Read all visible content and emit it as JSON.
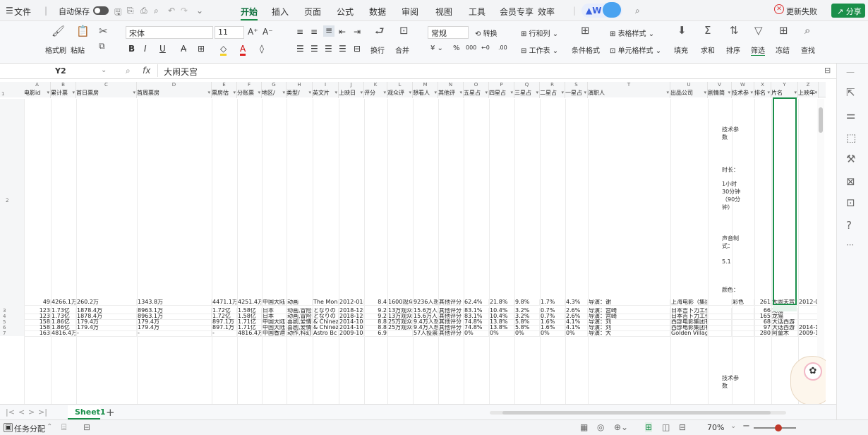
{
  "menubar": {
    "file": "文件",
    "autosave": "自动保存",
    "tabs": [
      "开始",
      "插入",
      "页面",
      "公式",
      "数据",
      "审阅",
      "视图",
      "工具",
      "会员专享",
      "效率"
    ],
    "active_tab": "开始",
    "update_failed": "更新失败",
    "share": "分享",
    "accent": "#1a8f4a"
  },
  "ribbon": {
    "format_painter": "格式刷",
    "paste": "粘贴",
    "font_name": "宋体",
    "font_size": "11",
    "number_format": "常规",
    "convert": "转换",
    "rows_cols": "行和列",
    "worksheet": "工作表",
    "wrap": "换行",
    "merge": "合并",
    "cond_format": "条件格式",
    "cell_style": "单元格样式",
    "table_style": "表格样式",
    "fill": "填充",
    "sum": "求和",
    "sort": "排序",
    "filter": "筛选",
    "freeze": "冻结",
    "find": "查找"
  },
  "formula_bar": {
    "cell_ref": "Y2",
    "fx": "fx",
    "value": "大闹天宫"
  },
  "columns": [
    "A",
    "B",
    "C",
    "D",
    "E",
    "F",
    "G",
    "H",
    "I",
    "J",
    "K",
    "L",
    "M",
    "N",
    "O",
    "P",
    "Q",
    "R",
    "S",
    "T",
    "U",
    "V",
    "W",
    "X",
    "Y",
    "Z"
  ],
  "headers": [
    "电影id",
    "累计票",
    "首日票房",
    "首周票房",
    "票房估",
    "分账票",
    "地区/",
    "类型/",
    "英文片",
    "上映日",
    "评分",
    "观众评",
    "想看人",
    "其他评",
    "五星占",
    "四星占",
    "三星占",
    "二星占",
    "一星占",
    "演职人",
    "出品公司",
    "剧情简",
    "技术参",
    "排名",
    "片名",
    "上映年"
  ],
  "row2_tech": {
    "label": "技术参数",
    "duration_label": "时长：",
    "duration": "1小时30分钟（90分钟）",
    "sound_label": "声音制式：",
    "sound": "5.1",
    "color_label": "颜色："
  },
  "rows": [
    {
      "num": "2",
      "a": "49",
      "b": "4266.1万",
      "c": "260.2万",
      "d": "1343.8万",
      "e": "4471.1万",
      "f": "4251.4万",
      "g": "中国大陆",
      "h": "动画",
      "i": "The Monk",
      "j": "2012-01-",
      "k": "8.4",
      "l": "1600观众",
      "m": "9236人想",
      "n": "其他评分",
      "o": "62.4%",
      "p": "21.8%",
      "q": "9.8%",
      "r": "1.7%",
      "s": "4.3%",
      "t": "导演：谢",
      "u": "上海电影（集团）有限公司,上海在花果山",
      "v": "",
      "w": "彩色",
      "x": "261",
      "y": "大闹天宫",
      "z": "2012-0"
    },
    {
      "num": "3",
      "a": "123",
      "b": "1.73亿",
      "c": "1878.4万",
      "d": "8963.1万",
      "e": "1.72亿",
      "f": "1.58亿",
      "g": "日本",
      "h": "动画,冒险",
      "i": "となりの",
      "j": "2018-12-",
      "k": "9.2",
      "l": "13万观众",
      "m": "15.6万人",
      "n": "其他评分",
      "o": "83.1%",
      "p": "10.4%",
      "q": "3.2%",
      "r": "0.7%",
      "s": "2.6%",
      "t": "导演：宫崎",
      "u": "日本吉卜力工作室,华夏电影发行为了方便",
      "v": "",
      "w": "",
      "x": "66",
      "y": "龙猫",
      "z": ""
    },
    {
      "num": "4",
      "a": "123",
      "b": "1.73亿",
      "c": "1878.4万",
      "d": "8963.1万",
      "e": "1.72亿",
      "f": "1.58亿",
      "g": "日本",
      "h": "动画,冒险",
      "i": "となりの",
      "j": "2018-12-",
      "k": "9.2",
      "l": "13万观众",
      "m": "15.6万人",
      "n": "其他评分",
      "o": "83.1%",
      "p": "10.4%",
      "q": "3.2%",
      "r": "0.7%",
      "s": "2.6%",
      "t": "导演：宫崎",
      "u": "日本吉卜力工作室,华夏电影发行为了方便",
      "v": "",
      "w": "",
      "x": "165",
      "y": "龙猫",
      "z": ""
    },
    {
      "num": "5",
      "a": "158",
      "b": "1.86亿",
      "c": "179.4万",
      "d": "179.4万",
      "e": "897.1万",
      "f": "1.71亿",
      "g": "中国大陆",
      "h": "喜剧,爱情",
      "i": "& Chinez",
      "j": "2014-10-",
      "k": "8.8",
      "l": "25万观众",
      "m": "9.4万人想",
      "n": "其他评分",
      "o": "74.8%",
      "p": "13.8%",
      "q": "5.8%",
      "r": "1.6%",
      "s": "4.1%",
      "t": "导演：刘",
      "u": "西部电影集团有限公司,香港影星英皇宝辉",
      "v": "",
      "w": "",
      "x": "68",
      "y": "大话西游",
      "z": ""
    },
    {
      "num": "6",
      "a": "158",
      "b": "1.86亿",
      "c": "179.4万",
      "d": "179.4万",
      "e": "897.1万",
      "f": "1.71亿",
      "g": "中国大陆",
      "h": "喜剧,爱情",
      "i": "& Chinez",
      "j": "2014-10-",
      "k": "8.8",
      "l": "25万观众",
      "m": "9.4万人想",
      "n": "其他评分",
      "o": "74.8%",
      "p": "13.8%",
      "q": "5.8%",
      "r": "1.6%",
      "s": "4.1%",
      "t": "导演：刘",
      "u": "西部电影集团有限公司,香港影星英皇宝辉",
      "v": "",
      "w": "",
      "x": "97",
      "y": "大话西游",
      "z": "2014-1"
    },
    {
      "num": "7",
      "a": "163",
      "b": "4816.4万",
      "c": "-",
      "d": "-",
      "e": "-",
      "f": "4816.4万",
      "g": "中国香港",
      "h": "动作,科幻",
      "i": "Astro Bc",
      "j": "2009-10-",
      "k": "6.9",
      "l": "",
      "m": "57人投票",
      "n": "其他评分",
      "o": "0%",
      "p": "0%",
      "q": "0%",
      "r": "0%",
      "s": "0%",
      "t": "导演：大",
      "u": "Golden Village Pictures,Bel天马博士",
      "v": "",
      "w": "",
      "x": "280",
      "y": "阿童木",
      "z": "2009-1"
    }
  ],
  "bottom_tech": "技术参数",
  "sheet": {
    "name": "Sheet1",
    "add": "+"
  },
  "status": {
    "task": "任务分配",
    "zoom": "70%"
  }
}
